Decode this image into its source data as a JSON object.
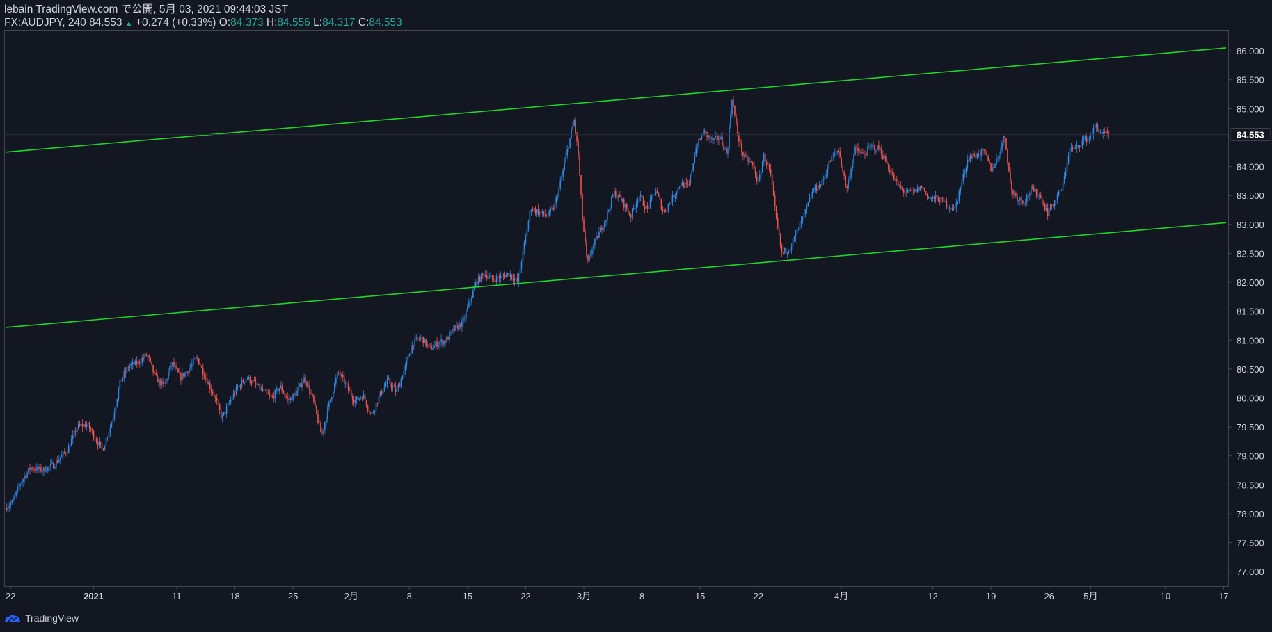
{
  "header": {
    "published": "lebain TradingView.com で公開, 5月 03, 2021 09:44:03 JST",
    "symbol": "FX:AUDJPY, 240",
    "last": "84.553",
    "change": "+0.274 (+0.33%)",
    "o_label": "O:",
    "o_value": "84.373",
    "h_label": "H:",
    "h_value": "84.556",
    "l_label": "L:",
    "l_value": "84.317",
    "c_label": "C:",
    "c_value": "84.553"
  },
  "footer": {
    "brand": "TradingView"
  },
  "colors": {
    "background": "#131722",
    "bull": "#2e8ae6",
    "bear": "#ef5350",
    "trendline": "#21d62a",
    "axis_text": "#d1d4dc",
    "last_price_bg": "#131722"
  },
  "chart_data": {
    "type": "candlestick",
    "symbol": "FX:AUDJPY",
    "interval": "240",
    "ylim": [
      76.75,
      86.35
    ],
    "y_ticks": [
      "77.000",
      "77.500",
      "78.000",
      "78.500",
      "79.000",
      "79.500",
      "80.000",
      "80.500",
      "81.000",
      "81.500",
      "82.000",
      "82.500",
      "83.000",
      "83.500",
      "84.000",
      "84.500",
      "85.000",
      "85.500",
      "86.000"
    ],
    "x_ticks": [
      {
        "label": "22",
        "day": -10
      },
      {
        "label": "2021",
        "day": 0
      },
      {
        "label": "11",
        "day": 10
      },
      {
        "label": "18",
        "day": 17
      },
      {
        "label": "25",
        "day": 24
      },
      {
        "label": "2月",
        "day": 31
      },
      {
        "label": "8",
        "day": 38
      },
      {
        "label": "15",
        "day": 45
      },
      {
        "label": "22",
        "day": 52
      },
      {
        "label": "3月",
        "day": 59
      },
      {
        "label": "8",
        "day": 66
      },
      {
        "label": "15",
        "day": 73
      },
      {
        "label": "22",
        "day": 80
      },
      {
        "label": "4月",
        "day": 90
      },
      {
        "label": "12",
        "day": 101
      },
      {
        "label": "19",
        "day": 108
      },
      {
        "label": "26",
        "day": 115
      },
      {
        "label": "5月",
        "day": 120
      },
      {
        "label": "10",
        "day": 129
      },
      {
        "label": "17",
        "day": 136
      }
    ],
    "xlim_days": [
      -10.6,
      136.3
    ],
    "last_price": "84.553",
    "price_path": [
      [
        -10.5,
        78.1
      ],
      [
        -9.6,
        78.2
      ],
      [
        -8.6,
        78.55
      ],
      [
        -7.4,
        78.8
      ],
      [
        -6.0,
        78.75
      ],
      [
        -4.6,
        78.85
      ],
      [
        -3.0,
        79.1
      ],
      [
        -1.8,
        79.5
      ],
      [
        -0.6,
        79.55
      ],
      [
        0.4,
        79.3
      ],
      [
        1.2,
        79.1
      ],
      [
        2.4,
        79.6
      ],
      [
        3.4,
        80.3
      ],
      [
        4.4,
        80.55
      ],
      [
        5.4,
        80.6
      ],
      [
        6.6,
        80.75
      ],
      [
        7.6,
        80.35
      ],
      [
        8.6,
        80.2
      ],
      [
        9.6,
        80.6
      ],
      [
        10.6,
        80.35
      ],
      [
        11.6,
        80.5
      ],
      [
        12.6,
        80.7
      ],
      [
        13.8,
        80.3
      ],
      [
        14.8,
        80.0
      ],
      [
        15.6,
        79.65
      ],
      [
        16.6,
        79.95
      ],
      [
        17.6,
        80.2
      ],
      [
        18.6,
        80.35
      ],
      [
        19.6,
        80.25
      ],
      [
        20.6,
        80.1
      ],
      [
        21.6,
        80.0
      ],
      [
        22.6,
        80.2
      ],
      [
        23.6,
        79.95
      ],
      [
        24.6,
        80.1
      ],
      [
        25.6,
        80.35
      ],
      [
        26.6,
        79.95
      ],
      [
        27.6,
        79.35
      ],
      [
        28.6,
        79.95
      ],
      [
        29.6,
        80.45
      ],
      [
        30.6,
        80.2
      ],
      [
        31.6,
        79.95
      ],
      [
        32.6,
        80.05
      ],
      [
        33.6,
        79.7
      ],
      [
        34.6,
        80.05
      ],
      [
        35.6,
        80.3
      ],
      [
        36.6,
        80.1
      ],
      [
        37.6,
        80.5
      ],
      [
        38.6,
        80.95
      ],
      [
        39.6,
        81.05
      ],
      [
        40.6,
        80.85
      ],
      [
        41.6,
        80.95
      ],
      [
        42.6,
        81.0
      ],
      [
        43.6,
        81.2
      ],
      [
        44.6,
        81.3
      ],
      [
        45.4,
        81.65
      ],
      [
        46.2,
        82.0
      ],
      [
        47.2,
        82.15
      ],
      [
        48.2,
        82.05
      ],
      [
        49.2,
        82.1
      ],
      [
        50.2,
        82.15
      ],
      [
        51.2,
        82.0
      ],
      [
        52.0,
        82.65
      ],
      [
        52.8,
        83.3
      ],
      [
        53.8,
        83.2
      ],
      [
        54.8,
        83.15
      ],
      [
        55.6,
        83.3
      ],
      [
        56.4,
        83.75
      ],
      [
        57.2,
        84.3
      ],
      [
        58.0,
        84.8
      ],
      [
        58.5,
        84.2
      ],
      [
        59.0,
        83.1
      ],
      [
        59.6,
        82.3
      ],
      [
        60.2,
        82.6
      ],
      [
        61.0,
        82.85
      ],
      [
        61.8,
        83.1
      ],
      [
        62.8,
        83.55
      ],
      [
        63.8,
        83.4
      ],
      [
        64.8,
        83.15
      ],
      [
        65.8,
        83.5
      ],
      [
        66.8,
        83.25
      ],
      [
        67.8,
        83.6
      ],
      [
        68.8,
        83.2
      ],
      [
        69.8,
        83.45
      ],
      [
        70.8,
        83.7
      ],
      [
        71.8,
        83.65
      ],
      [
        72.6,
        84.3
      ],
      [
        73.6,
        84.6
      ],
      [
        74.6,
        84.45
      ],
      [
        75.6,
        84.5
      ],
      [
        76.4,
        84.2
      ],
      [
        77.0,
        85.2
      ],
      [
        77.6,
        84.6
      ],
      [
        78.4,
        84.15
      ],
      [
        79.4,
        84.05
      ],
      [
        80.2,
        83.7
      ],
      [
        80.8,
        84.2
      ],
      [
        81.6,
        83.9
      ],
      [
        82.4,
        83.0
      ],
      [
        83.0,
        82.5
      ],
      [
        84.0,
        82.6
      ],
      [
        84.8,
        82.85
      ],
      [
        85.8,
        83.2
      ],
      [
        86.8,
        83.6
      ],
      [
        87.8,
        83.7
      ],
      [
        88.8,
        84.1
      ],
      [
        89.8,
        84.3
      ],
      [
        90.8,
        83.6
      ],
      [
        91.8,
        84.3
      ],
      [
        92.8,
        84.2
      ],
      [
        93.8,
        84.35
      ],
      [
        94.8,
        84.3
      ],
      [
        95.8,
        84.0
      ],
      [
        96.8,
        83.7
      ],
      [
        97.8,
        83.55
      ],
      [
        98.8,
        83.55
      ],
      [
        99.8,
        83.65
      ],
      [
        100.8,
        83.45
      ],
      [
        101.8,
        83.45
      ],
      [
        102.8,
        83.35
      ],
      [
        103.8,
        83.25
      ],
      [
        104.6,
        83.7
      ],
      [
        105.4,
        84.15
      ],
      [
        106.4,
        84.2
      ],
      [
        107.4,
        84.25
      ],
      [
        108.2,
        83.95
      ],
      [
        109.0,
        84.15
      ],
      [
        109.8,
        84.55
      ],
      [
        110.6,
        83.6
      ],
      [
        111.4,
        83.45
      ],
      [
        112.2,
        83.4
      ],
      [
        113.0,
        83.6
      ],
      [
        114.0,
        83.5
      ],
      [
        115.0,
        83.2
      ],
      [
        116.0,
        83.45
      ],
      [
        116.8,
        83.65
      ],
      [
        117.6,
        84.3
      ],
      [
        118.4,
        84.3
      ],
      [
        119.2,
        84.45
      ],
      [
        120.0,
        84.5
      ],
      [
        120.8,
        84.7
      ],
      [
        121.6,
        84.55
      ],
      [
        122.2,
        84.553
      ]
    ],
    "trendlines": [
      {
        "name": "upper-channel",
        "points": [
          [
            -10.6,
            84.25
          ],
          [
            136.3,
            86.05
          ]
        ]
      },
      {
        "name": "lower-channel",
        "points": [
          [
            -10.6,
            81.22
          ],
          [
            136.3,
            83.03
          ]
        ]
      }
    ]
  }
}
